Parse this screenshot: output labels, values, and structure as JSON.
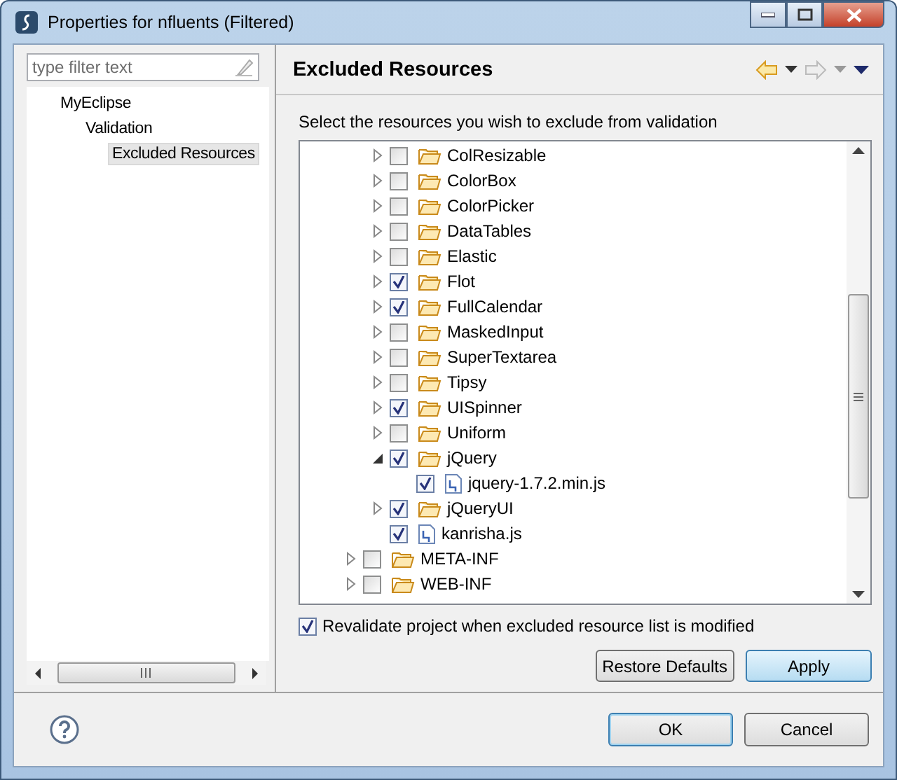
{
  "window": {
    "title": "Properties for nfluents (Filtered)"
  },
  "sidebar": {
    "filter": {
      "placeholder": "type filter text"
    },
    "items": [
      {
        "label": "MyEclipse",
        "selected": false,
        "children": [
          {
            "label": "Validation",
            "selected": false,
            "children": [
              {
                "label": "Excluded Resources",
                "selected": true
              }
            ]
          }
        ]
      }
    ]
  },
  "page": {
    "title": "Excluded Resources",
    "instruction": "Select the resources you wish to exclude from validation",
    "tree": {
      "inner_items": [
        {
          "label": "ColResizable",
          "kind": "folder",
          "checked": false,
          "expanded": false
        },
        {
          "label": "ColorBox",
          "kind": "folder",
          "checked": false,
          "expanded": false
        },
        {
          "label": "ColorPicker",
          "kind": "folder",
          "checked": false,
          "expanded": false
        },
        {
          "label": "DataTables",
          "kind": "folder",
          "checked": false,
          "expanded": false
        },
        {
          "label": "Elastic",
          "kind": "folder",
          "checked": false,
          "expanded": false
        },
        {
          "label": "Flot",
          "kind": "folder",
          "checked": true,
          "expanded": false
        },
        {
          "label": "FullCalendar",
          "kind": "folder",
          "checked": true,
          "expanded": false
        },
        {
          "label": "MaskedInput",
          "kind": "folder",
          "checked": false,
          "expanded": false
        },
        {
          "label": "SuperTextarea",
          "kind": "folder",
          "checked": false,
          "expanded": false
        },
        {
          "label": "Tipsy",
          "kind": "folder",
          "checked": false,
          "expanded": false
        },
        {
          "label": "UISpinner",
          "kind": "folder",
          "checked": true,
          "expanded": false
        },
        {
          "label": "Uniform",
          "kind": "folder",
          "checked": false,
          "expanded": false
        },
        {
          "label": "jQuery",
          "kind": "folder",
          "checked": true,
          "expanded": true,
          "children": [
            {
              "label": "jquery-1.7.2.min.js",
              "kind": "file",
              "checked": true
            }
          ]
        },
        {
          "label": "jQueryUI",
          "kind": "folder",
          "checked": true,
          "expanded": false
        },
        {
          "label": "kanrisha.js",
          "kind": "file",
          "checked": true
        }
      ],
      "outer_items": [
        {
          "label": "META-INF",
          "kind": "folder",
          "checked": false,
          "expanded": false
        },
        {
          "label": "WEB-INF",
          "kind": "folder",
          "checked": false,
          "expanded": false
        }
      ]
    },
    "revalidate": {
      "label": "Revalidate project when excluded resource list is modified",
      "checked": true
    },
    "buttons": [
      "Restore Defaults",
      "Apply"
    ]
  },
  "dialog_buttons": [
    "OK",
    "Cancel"
  ]
}
